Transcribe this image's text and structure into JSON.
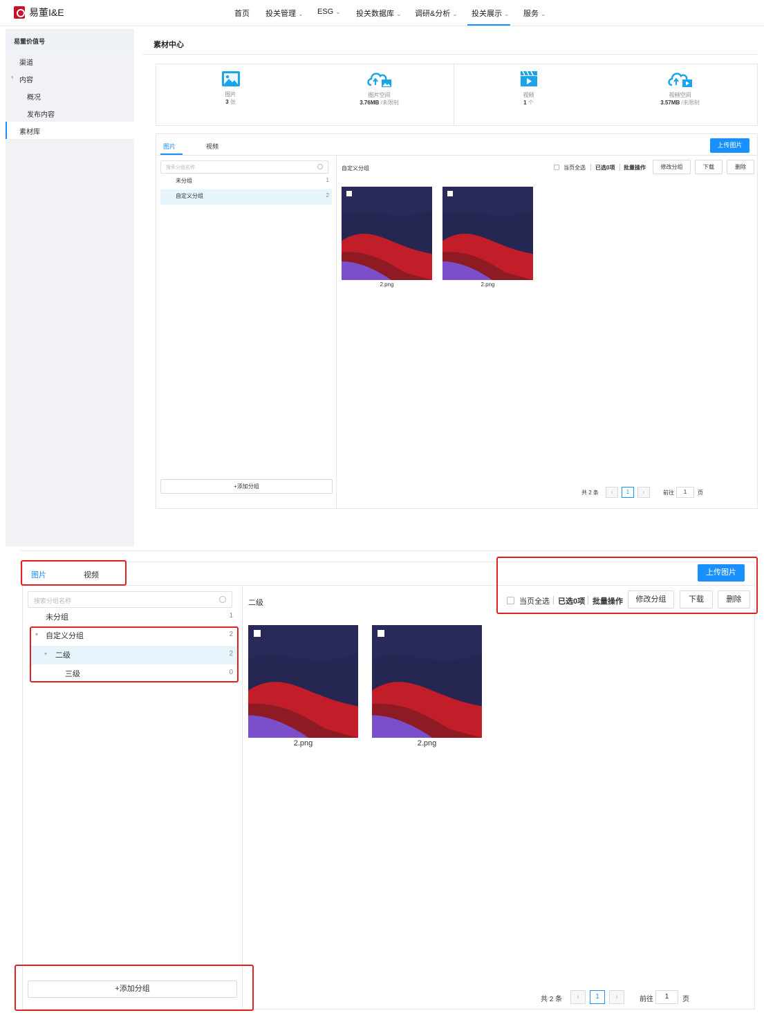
{
  "app": {
    "name": "易董I&E"
  },
  "nav": {
    "items": [
      "首页",
      "投关管理",
      "ESG",
      "投关数据库",
      "调研&分析",
      "投关展示",
      "服务"
    ],
    "active": "投关展示",
    "accent": "#1890ff"
  },
  "sidebar": {
    "header": "易董价值号",
    "items": [
      "渠道",
      "内容",
      "概况",
      "发布内容",
      "素材库"
    ]
  },
  "page": {
    "title": "素材中心"
  },
  "stats": [
    {
      "label": "图片",
      "value": "3",
      "unit": "张",
      "icon": "image-icon"
    },
    {
      "label": "图片空间",
      "value": "3.76MB",
      "unit": "/未限制",
      "icon": "cloud-upload-image-icon"
    },
    {
      "label": "视频",
      "value": "1",
      "unit": "个",
      "icon": "video-clapper-icon"
    },
    {
      "label": "视频空间",
      "value": "3.57MB",
      "unit": "/未限制",
      "icon": "cloud-upload-video-icon"
    }
  ],
  "upper": {
    "tabs": [
      "图片",
      "视频"
    ],
    "upload_label": "上传图片",
    "search_placeholder": "搜索分组名称",
    "groups": [
      {
        "name": "未分组",
        "count": "1"
      },
      {
        "name": "自定义分组",
        "count": "2"
      }
    ],
    "current_group": "自定义分组",
    "toolbar": {
      "select_all": "当页全选",
      "selected": "已选0项",
      "batch": "批量操作",
      "edit_group": "修改分组",
      "download": "下载",
      "delete": "删除"
    },
    "images": [
      "2.png",
      "2.png"
    ],
    "add_group": "+添加分组",
    "pagination": {
      "total": "共 2 条",
      "page": "1",
      "goto": "前往",
      "goto_value": "1",
      "page_unit": "页"
    }
  },
  "lower": {
    "tabs": [
      "图片",
      "视频"
    ],
    "upload_label": "上传图片",
    "search_placeholder": "搜索分组名称",
    "groups": [
      {
        "name": "未分组",
        "count": "1"
      },
      {
        "name": "自定义分组",
        "count": "2"
      },
      {
        "name": "二级",
        "count": "2"
      },
      {
        "name": "三级",
        "count": "0"
      }
    ],
    "current_group": "二级",
    "toolbar": {
      "select_all": "当页全选",
      "selected": "已选0项",
      "batch": "批量操作",
      "edit_group": "修改分组",
      "download": "下载",
      "delete": "删除"
    },
    "images": [
      "2.png",
      "2.png"
    ],
    "add_group": "+添加分组",
    "pagination": {
      "total": "共 2 条",
      "page": "1",
      "goto": "前往",
      "goto_value": "1",
      "page_unit": "页"
    }
  },
  "colors": {
    "highlight": "#e02020",
    "selected_row": "#e6f4fc",
    "sidebar_bg": "#f0f2f5"
  }
}
